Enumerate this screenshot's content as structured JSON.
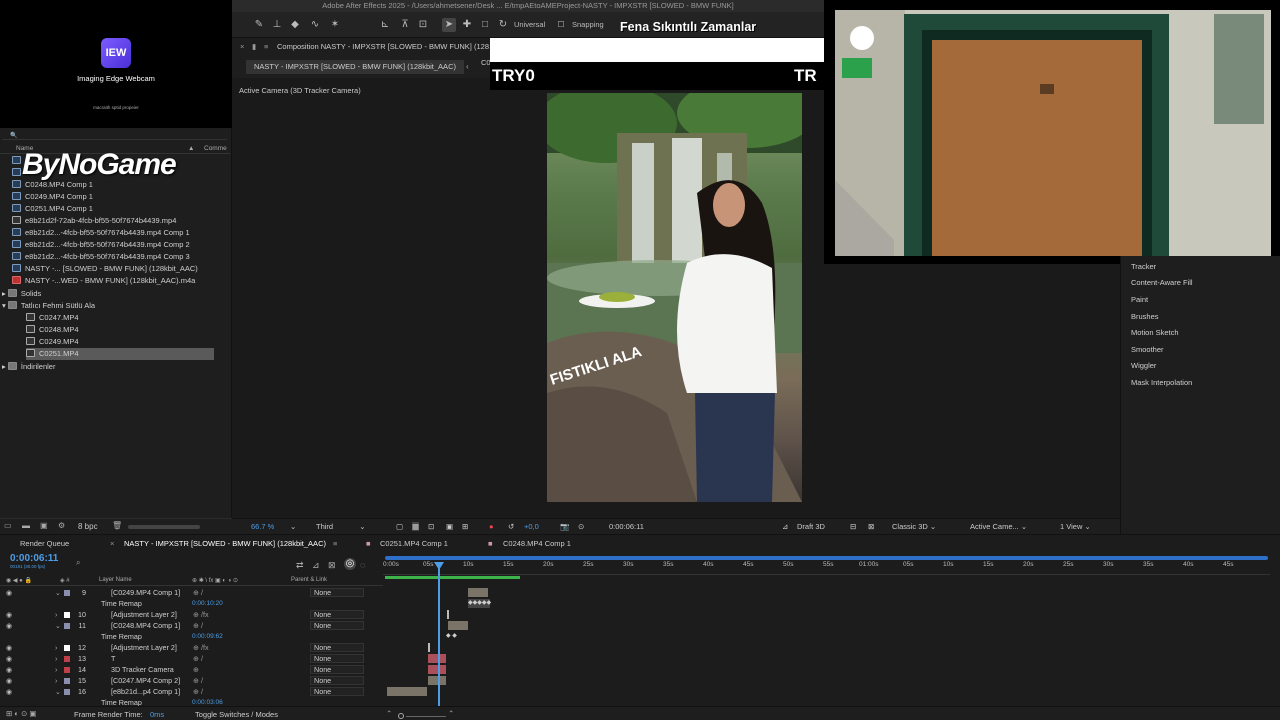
{
  "webcam": {
    "logo_text": "IEW",
    "name": "Imaging Edge Webcam",
    "sub": "macraith sptid propeier"
  },
  "window_title": "Adobe After Effects 2025 - /Users/ahmetsener/Desk ... E/tmpAEtoAMEProject-NASTY - IMPXSTR [SLOWED - BMW FUNK]",
  "toolbar": {
    "universal_label": "Universal",
    "snapping_label": "Snapping"
  },
  "overlay_title": "Fena Sıkıntılı Zamanlar",
  "watermark": "ByNoGame",
  "project": {
    "search_icon": "🔍",
    "col_name": "Name",
    "col_comment": "Comme",
    "items": [
      {
        "name": "C0248.MP4 Comp 1"
      },
      {
        "name": "C0249.MP4 Comp 1"
      },
      {
        "name": "C0251.MP4 Comp 1"
      },
      {
        "name": "e8b21d2f-72ab-4fcb-bf55-50f7674b4439.mp4"
      },
      {
        "name": "e8b21d2...-4fcb-bf55-50f7674b4439.mp4 Comp 1"
      },
      {
        "name": "e8b21d2...-4fcb-bf55-50f7674b4439.mp4 Comp 2"
      },
      {
        "name": "e8b21d2...-4fcb-bf55-50f7674b4439.mp4 Comp 3"
      },
      {
        "name": "NASTY -... [SLOWED - BMW FUNK] (128kbit_AAC)"
      },
      {
        "name": "NASTY -...WED - BMW FUNK] (128kbit_AAC).m4a"
      },
      {
        "name": "Solids"
      },
      {
        "name": "Tatlıcı Fehmi Sütlü Ala"
      },
      {
        "name": "C0247.MP4"
      },
      {
        "name": "C0248.MP4"
      },
      {
        "name": "C0249.MP4"
      },
      {
        "name": "C0251.MP4"
      },
      {
        "name": "İndirilenler"
      }
    ],
    "bpc": "8 bpc"
  },
  "composition": {
    "tab_label": "Composition NASTY - IMPXSTR [SLOWED - BMW FUNK] (128",
    "subtab_active": "NASTY - IMPXSTR [SLOWED - BMW FUNK] (128kbit_AAC)",
    "subtab_2": "C0248.MP4 Comp 1",
    "camera_label": "Active Camera (3D Tracker Camera)",
    "tryo_text": "TRY0",
    "tryo_text2": "TR",
    "video_caption": "FISTIKLI ALA",
    "zoom": "66.7 %",
    "resolution": "Third",
    "exposure": "+0,0",
    "timecode": "0:00:06:11",
    "draft": "Draft 3D",
    "renderer": "Classic 3D",
    "camera_select": "Active Came...",
    "view": "1 View"
  },
  "right_panel": {
    "items": [
      "Tracker",
      "Content-Aware Fill",
      "Paint",
      "Brushes",
      "Motion Sketch",
      "Smoother",
      "Wiggler",
      "Mask Interpolation"
    ]
  },
  "timeline": {
    "tabs": [
      "Render Queue",
      "NASTY - IMPXSTR [SLOWED - BMW FUNK] (128kbit_AAC)",
      "C0251.MP4 Comp 1",
      "C0248.MP4 Comp 1"
    ],
    "timecode": "0:00:06:11",
    "fps": "00191 (30.00 fps)",
    "col_layer_name": "Layer Name",
    "col_parent": "Parent & Link",
    "ruler": [
      "0:00s",
      "05s",
      "10s",
      "15s",
      "20s",
      "25s",
      "30s",
      "35s",
      "40s",
      "45s",
      "50s",
      "55s",
      "01:00s",
      "05s",
      "10s",
      "15s",
      "20s",
      "25s",
      "30s",
      "35s",
      "40s",
      "45s"
    ],
    "layers": [
      {
        "num": "9",
        "name": "[C0249.MP4 Comp 1]",
        "parent": "None",
        "color": "#8a8fb0"
      },
      {
        "sub": true,
        "name": "Time Remap",
        "value": "0:00:10:20"
      },
      {
        "num": "10",
        "name": "[Adjustment Layer 2]",
        "parent": "None",
        "color": "#ffffff"
      },
      {
        "num": "11",
        "name": "[C0248.MP4 Comp 1]",
        "parent": "None",
        "color": "#8a8fb0"
      },
      {
        "sub": true,
        "name": "Time Remap",
        "value": "0:00:09:62"
      },
      {
        "num": "12",
        "name": "[Adjustment Layer 2]",
        "parent": "None",
        "color": "#ffffff"
      },
      {
        "num": "13",
        "name": "T",
        "parent": "None",
        "color": "#c0404a"
      },
      {
        "num": "14",
        "name": "3D Tracker Camera",
        "parent": "None",
        "color": "#c0404a"
      },
      {
        "num": "15",
        "name": "[C0247.MP4 Comp 2]",
        "parent": "None",
        "color": "#8a8fb0"
      },
      {
        "num": "16",
        "name": "[e8b21d...p4 Comp 1]",
        "parent": "None",
        "color": "#8a8fb0"
      },
      {
        "sub": true,
        "name": "Time Remap",
        "value": "0:00:03:06"
      }
    ],
    "footer_label": "Frame Render Time:",
    "footer_value": "0ms",
    "toggle_label": "Toggle Switches / Modes"
  }
}
